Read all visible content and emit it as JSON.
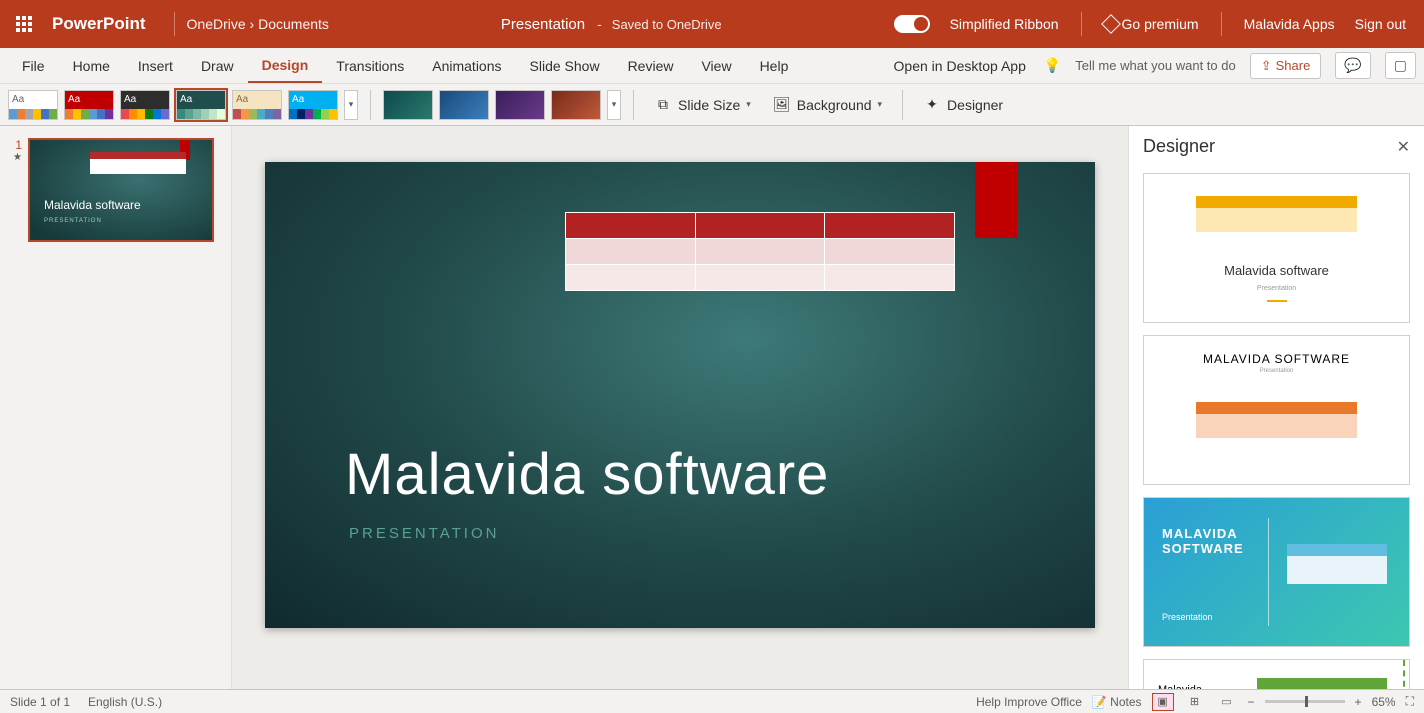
{
  "titlebar": {
    "app_name": "PowerPoint",
    "breadcrumb_root": "OneDrive",
    "breadcrumb_chevron": "›",
    "breadcrumb_folder": "Documents",
    "doc_title": "Presentation",
    "save_status_dash": "-",
    "save_status": "Saved to OneDrive",
    "simplified_ribbon": "Simplified Ribbon",
    "go_premium": "Go premium",
    "user": "Malavida Apps",
    "sign_out": "Sign out"
  },
  "tabs": [
    "File",
    "Home",
    "Insert",
    "Draw",
    "Design",
    "Transitions",
    "Animations",
    "Slide Show",
    "Review",
    "View",
    "Help"
  ],
  "active_tab": "Design",
  "ribbon_right": {
    "open_desktop": "Open in Desktop App",
    "tell_me": "Tell me what you want to do",
    "share": "Share"
  },
  "ribbon": {
    "slide_size": "Slide Size",
    "background": "Background",
    "designer": "Designer",
    "theme_label": "Aa"
  },
  "thumbnail": {
    "number": "1",
    "star": "★",
    "title": "Malavida software",
    "subtitle": "PRESENTATION"
  },
  "slide": {
    "title": "Malavida software",
    "subtitle": "PRESENTATION"
  },
  "designer_pane": {
    "title": "Designer",
    "d1_title": "Malavida software",
    "d1_sub": "Presentation",
    "d2_title": "MALAVIDA SOFTWARE",
    "d2_sub": "Presentation",
    "d3_title": "MALAVIDA\nSOFTWARE",
    "d3_sub": "Presentation",
    "d4_title": "Malavida software"
  },
  "statusbar": {
    "slide_info": "Slide 1 of 1",
    "language": "English (U.S.)",
    "help_improve": "Help Improve Office",
    "notes": "Notes",
    "zoom": "65%"
  }
}
